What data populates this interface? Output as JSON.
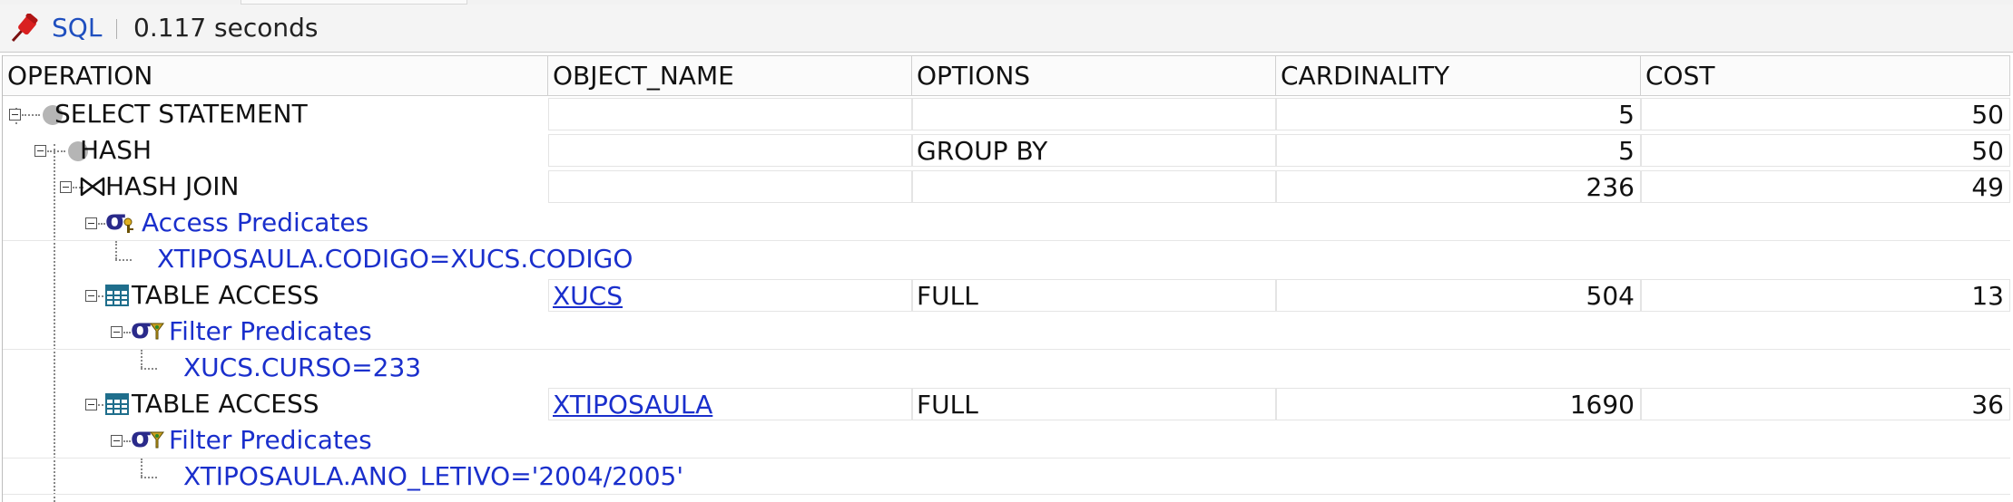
{
  "toolbar": {
    "pin_icon": "pushpin-icon",
    "sql_label": "SQL",
    "elapsed": "0.117 seconds"
  },
  "columns": [
    "OPERATION",
    "OBJECT_NAME",
    "OPTIONS",
    "CARDINALITY",
    "COST"
  ],
  "rows": [
    {
      "operation": "SELECT STATEMENT",
      "icon": "circle-node-icon",
      "object_name": "",
      "options": "",
      "cardinality": "5",
      "cost": "50"
    },
    {
      "operation": "HASH",
      "icon": "circle-node-icon",
      "object_name": "",
      "options": "GROUP BY",
      "cardinality": "5",
      "cost": "50"
    },
    {
      "operation": "HASH JOIN",
      "icon": "hash-join-icon",
      "object_name": "",
      "options": "",
      "cardinality": "236",
      "cost": "49"
    },
    {
      "operation": "Access Predicates",
      "icon": "access-predicate-icon"
    },
    {
      "operation": "XTIPOSAULA.CODIGO=XUCS.CODIGO"
    },
    {
      "operation": "TABLE ACCESS",
      "icon": "table-icon",
      "object_name": "XUCS",
      "options": "FULL",
      "cardinality": "504",
      "cost": "13"
    },
    {
      "operation": "Filter Predicates",
      "icon": "filter-predicate-icon"
    },
    {
      "operation": "XUCS.CURSO=233"
    },
    {
      "operation": "TABLE ACCESS",
      "icon": "table-icon",
      "object_name": "XTIPOSAULA",
      "options": "FULL",
      "cardinality": "1690",
      "cost": "36"
    },
    {
      "operation": "Filter Predicates",
      "icon": "filter-predicate-icon"
    },
    {
      "operation": "XTIPOSAULA.ANO_LETIVO='2004/2005'"
    }
  ]
}
